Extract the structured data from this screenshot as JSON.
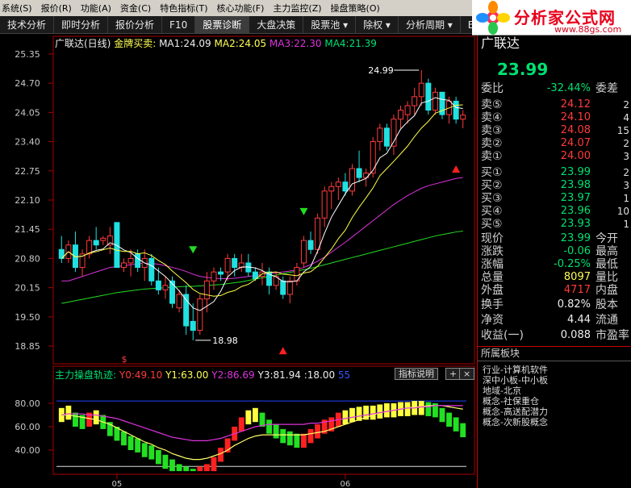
{
  "menu": [
    "系统(S)",
    "报价(R)",
    "功能(A)",
    "资金(C)",
    "特色指标(T)",
    "核心功能(F)",
    "主力监控(Z)",
    "操盘策略(O)"
  ],
  "toolbar": [
    "技术分析",
    "即时分析",
    "报价分析",
    "F10",
    "股票诊断",
    "大盘决策",
    "股票池 ▾",
    "除权 ▾",
    "分析周期 ▾",
    "E 窗口"
  ],
  "logo": {
    "text": "分析家公式网",
    "url": "www.88gs.com"
  },
  "chart_title": {
    "name": "广联达(日线)",
    "indicator": "金牌买卖:",
    "ma1": "MA1:24.09",
    "ma2": "MA2:24.05",
    "ma3": "MA3:22.30",
    "ma4": "MA4:21.39"
  },
  "price_axis": [
    "25.35",
    "24.70",
    "24.05",
    "23.40",
    "22.75",
    "22.10",
    "21.45",
    "20.80",
    "20.15",
    "19.50",
    "18.85"
  ],
  "annotations": {
    "high": "24.99",
    "low": "18.98",
    "dollar": "$"
  },
  "indicator": {
    "name": "主力操盘轨迹:",
    "y0": "Y0:49.10",
    "y1": "Y1:63.00",
    "y2": "Y2:86.69",
    "y3": "Y3:81.94",
    "extra": ":18.00",
    "extra2": "55",
    "explain_btn": "指标说明",
    "axis": [
      "80.00",
      "60.00",
      "40.00"
    ]
  },
  "date_axis": [
    "05",
    "06"
  ],
  "right": {
    "stock_name": "广联达",
    "price": "23.99",
    "weibi_label": "委比",
    "weibi_value": "-32.44%",
    "weicha_label": "委差",
    "asks": [
      {
        "label": "卖⑤",
        "price": "24.12",
        "vol": "2"
      },
      {
        "label": "卖④",
        "price": "24.10",
        "vol": "4"
      },
      {
        "label": "卖③",
        "price": "24.08",
        "vol": "15"
      },
      {
        "label": "卖②",
        "price": "24.07",
        "vol": "2"
      },
      {
        "label": "卖①",
        "price": "24.00",
        "vol": "3"
      }
    ],
    "bids": [
      {
        "label": "买①",
        "price": "23.99",
        "vol": "2"
      },
      {
        "label": "买②",
        "price": "23.98",
        "vol": "3"
      },
      {
        "label": "买③",
        "price": "23.97",
        "vol": "1"
      },
      {
        "label": "买④",
        "price": "23.96",
        "vol": "10"
      },
      {
        "label": "买⑤",
        "price": "23.93",
        "vol": "1"
      }
    ],
    "stats": [
      {
        "label": "现价",
        "value": "23.99",
        "label2": "今开",
        "cls": "green"
      },
      {
        "label": "涨跌",
        "value": "-0.06",
        "label2": "最高",
        "cls": "green"
      },
      {
        "label": "涨幅",
        "value": "-0.25%",
        "label2": "最低",
        "cls": "green"
      },
      {
        "label": "总量",
        "value": "8097",
        "label2": "量比",
        "cls": "yellow"
      },
      {
        "label": "外盘",
        "value": "4717",
        "label2": "内盘",
        "cls": "red"
      }
    ],
    "stats2": [
      {
        "label": "换手",
        "value": "0.82%",
        "label2": "股本"
      },
      {
        "label": "净资",
        "value": "4.44",
        "label2": "流通"
      },
      {
        "label": "收益(一)",
        "value": "0.088",
        "label2": "市盈率"
      }
    ],
    "sector_title": "所属板块",
    "sectors": [
      "行业-计算机软件",
      "深中小板-中小板",
      "地域-北京",
      "概念-社保重仓",
      "概念-高送配潜力",
      "概念-次新股概念"
    ]
  },
  "chart_data": [
    {
      "type": "candlestick",
      "title": "广联达(日线)",
      "ylim": [
        18.6,
        25.6
      ],
      "series_colors": {
        "up": "#ff3b3b",
        "down": "#20e0e0",
        "ma1": "#ffffff",
        "ma2": "#ffff44",
        "ma3": "#dd33dd",
        "ma4": "#22dd22"
      },
      "candles": [
        [
          21.0,
          21.3,
          20.7,
          20.8
        ],
        [
          20.8,
          21.2,
          20.7,
          21.1
        ],
        [
          21.1,
          21.4,
          20.5,
          20.6
        ],
        [
          20.6,
          21.0,
          20.4,
          20.9
        ],
        [
          20.9,
          21.3,
          20.8,
          21.2
        ],
        [
          21.2,
          21.5,
          21.0,
          21.1
        ],
        [
          21.2,
          21.3,
          21.1,
          21.25
        ],
        [
          21.1,
          21.5,
          20.9,
          21.3
        ],
        [
          21.6,
          21.6,
          20.6,
          20.6
        ],
        [
          20.6,
          20.8,
          20.5,
          20.7
        ],
        [
          20.7,
          21.0,
          20.4,
          20.8
        ],
        [
          20.9,
          21.0,
          20.5,
          20.6
        ],
        [
          20.6,
          21.0,
          20.3,
          20.8
        ],
        [
          20.8,
          20.9,
          20.2,
          20.3
        ],
        [
          20.3,
          20.6,
          20.0,
          20.1
        ],
        [
          20.1,
          20.4,
          19.9,
          20.2
        ],
        [
          20.3,
          20.4,
          19.7,
          19.8
        ],
        [
          19.7,
          20.1,
          19.6,
          20.0
        ],
        [
          20.0,
          20.2,
          19.1,
          19.3
        ],
        [
          19.4,
          19.8,
          18.98,
          19.2
        ],
        [
          19.2,
          20.0,
          19.1,
          19.9
        ],
        [
          19.9,
          20.5,
          19.6,
          20.3
        ],
        [
          20.3,
          20.6,
          20.1,
          20.5
        ],
        [
          20.5,
          20.6,
          20.3,
          20.45
        ],
        [
          20.5,
          20.9,
          20.3,
          20.8
        ],
        [
          20.8,
          20.9,
          20.4,
          20.6
        ],
        [
          20.6,
          20.9,
          20.5,
          20.7
        ],
        [
          20.7,
          20.9,
          20.4,
          20.5
        ],
        [
          20.5,
          20.6,
          20.3,
          20.35
        ],
        [
          20.4,
          20.7,
          20.2,
          20.5
        ],
        [
          20.5,
          20.6,
          20.0,
          20.2
        ],
        [
          20.2,
          20.5,
          20.1,
          20.4
        ],
        [
          20.3,
          20.4,
          19.9,
          20.0
        ],
        [
          20.0,
          20.4,
          19.8,
          20.3
        ],
        [
          20.3,
          20.7,
          20.2,
          20.6
        ],
        [
          20.7,
          21.3,
          20.6,
          21.2
        ],
        [
          21.2,
          21.4,
          20.9,
          21.0
        ],
        [
          21.0,
          21.8,
          20.9,
          21.7
        ],
        [
          21.7,
          22.4,
          21.5,
          22.3
        ],
        [
          22.3,
          22.5,
          21.9,
          22.4
        ],
        [
          22.4,
          22.6,
          22.1,
          22.5
        ],
        [
          22.5,
          22.7,
          22.2,
          22.3
        ],
        [
          22.3,
          22.9,
          22.2,
          22.8
        ],
        [
          22.8,
          23.2,
          22.5,
          22.6
        ],
        [
          22.6,
          22.8,
          22.4,
          22.7
        ],
        [
          22.7,
          23.5,
          22.6,
          23.4
        ],
        [
          23.4,
          23.8,
          23.2,
          23.7
        ],
        [
          23.7,
          23.8,
          23.2,
          23.3
        ],
        [
          23.3,
          24.0,
          23.1,
          23.9
        ],
        [
          23.9,
          24.2,
          23.7,
          24.1
        ],
        [
          24.0,
          24.3,
          23.8,
          24.2
        ],
        [
          24.2,
          24.6,
          24.0,
          24.4
        ],
        [
          24.4,
          24.99,
          24.2,
          24.7
        ],
        [
          24.7,
          24.8,
          24.0,
          24.1
        ],
        [
          24.1,
          24.6,
          24.0,
          24.5
        ],
        [
          24.5,
          24.5,
          23.9,
          24.0
        ],
        [
          24.0,
          24.4,
          23.8,
          24.3
        ],
        [
          24.3,
          24.4,
          23.8,
          23.9
        ],
        [
          23.9,
          24.1,
          23.7,
          23.99
        ]
      ],
      "ma3": [
        20.3,
        20.3,
        20.35,
        20.4,
        20.45,
        20.5,
        20.55,
        20.6,
        20.62,
        20.64,
        20.66,
        20.68,
        20.7,
        20.69,
        20.67,
        20.64,
        20.6,
        20.56,
        20.51,
        20.45,
        20.4,
        20.38,
        20.36,
        20.35,
        20.35,
        20.36,
        20.38,
        20.4,
        20.42,
        20.44,
        20.46,
        20.48,
        20.5,
        20.52,
        20.55,
        20.6,
        20.66,
        20.74,
        20.83,
        20.94,
        21.05,
        21.16,
        21.28,
        21.4,
        21.52,
        21.64,
        21.76,
        21.88,
        22.0,
        22.1,
        22.2,
        22.28,
        22.36,
        22.42,
        22.46,
        22.5,
        22.54,
        22.58,
        22.6
      ],
      "ma4": [
        19.8,
        19.83,
        19.86,
        19.89,
        19.92,
        19.95,
        19.98,
        20.01,
        20.04,
        20.06,
        20.08,
        20.1,
        20.12,
        20.13,
        20.14,
        20.15,
        20.16,
        20.17,
        20.18,
        20.18,
        20.19,
        20.2,
        20.21,
        20.22,
        20.24,
        20.26,
        20.28,
        20.31,
        20.34,
        20.37,
        20.4,
        20.43,
        20.46,
        20.49,
        20.52,
        20.55,
        20.58,
        20.62,
        20.66,
        20.7,
        20.74,
        20.78,
        20.82,
        20.86,
        20.9,
        20.94,
        20.98,
        21.02,
        21.06,
        21.1,
        21.14,
        21.18,
        21.22,
        21.26,
        21.3,
        21.33,
        21.36,
        21.39,
        21.41
      ]
    },
    {
      "type": "bar",
      "title": "主力操盘轨迹",
      "ylim": [
        20,
        100
      ],
      "values": [
        76,
        78,
        72,
        70,
        72,
        74,
        70,
        64,
        60,
        56,
        52,
        50,
        46,
        44,
        40,
        36,
        32,
        28,
        26,
        24,
        26,
        28,
        34,
        42,
        50,
        60,
        68,
        74,
        76,
        72,
        66,
        62,
        58,
        56,
        54,
        54,
        58,
        62,
        66,
        68,
        72,
        74,
        76,
        77,
        78,
        78,
        79,
        80,
        80,
        81,
        81,
        82,
        82,
        81,
        80,
        76,
        72,
        68,
        63
      ],
      "line1": [
        70,
        70,
        69,
        68,
        67,
        66,
        64,
        62,
        59,
        56,
        53,
        50,
        47,
        45,
        42,
        40,
        37,
        35,
        33,
        32,
        32,
        33,
        35,
        37,
        40,
        44,
        47,
        50,
        52,
        53,
        53,
        53,
        53,
        53,
        53,
        53,
        54,
        55,
        56,
        58,
        60,
        62,
        64,
        66,
        68,
        70,
        72,
        73,
        74,
        75,
        76,
        77,
        77,
        78,
        78,
        78,
        77,
        76,
        75
      ],
      "line2": [
        70,
        71,
        71,
        71,
        70,
        70,
        69,
        68,
        67,
        65,
        63,
        61,
        59,
        57,
        55,
        53,
        51,
        50,
        49,
        48,
        48,
        48,
        49,
        50,
        52,
        54,
        56,
        58,
        60,
        61,
        62,
        62,
        62,
        62,
        62,
        62,
        63,
        63,
        64,
        65,
        66,
        67,
        68,
        69,
        70,
        71,
        72,
        73,
        74,
        75,
        76,
        76,
        77,
        77,
        78,
        78,
        78,
        78,
        78
      ]
    }
  ]
}
